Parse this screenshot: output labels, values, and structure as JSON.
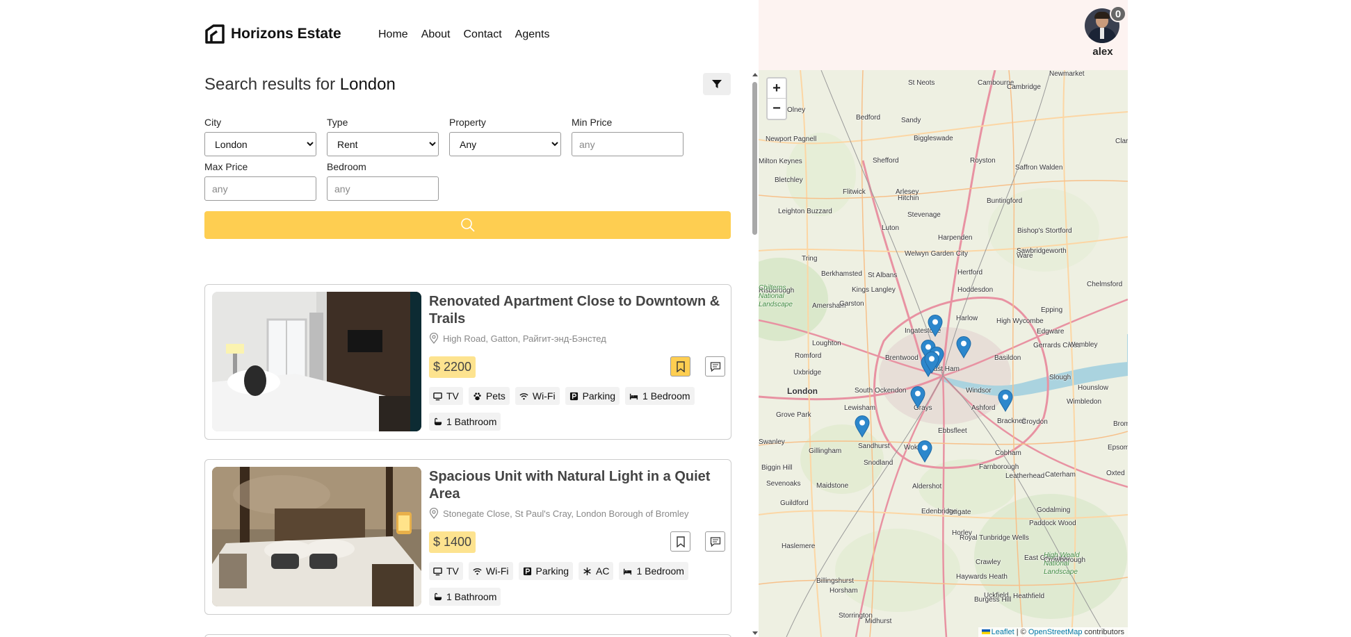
{
  "brand": {
    "name": "Horizons Estate"
  },
  "nav": {
    "home": "Home",
    "about": "About",
    "contact": "Contact",
    "agents": "Agents"
  },
  "user": {
    "name": "alex",
    "notification_count": "0"
  },
  "search": {
    "title_prefix": "Search results for",
    "title_city": "London",
    "fields": {
      "city": {
        "label": "City",
        "value": "London",
        "options": [
          "London"
        ]
      },
      "type": {
        "label": "Type",
        "value": "Rent",
        "options": [
          "Rent"
        ]
      },
      "property": {
        "label": "Property",
        "value": "Any",
        "options": [
          "Any"
        ]
      },
      "min_price": {
        "label": "Min Price",
        "placeholder": "any"
      },
      "max_price": {
        "label": "Max Price",
        "placeholder": "any"
      },
      "bedroom": {
        "label": "Bedroom",
        "placeholder": "any"
      }
    }
  },
  "listings": [
    {
      "title": "Renovated Apartment Close to Downtown & Trails",
      "address": "High Road, Gatton, Райгит-энд-Бэнстед",
      "price": "$ 2200",
      "saved": true,
      "features": [
        "TV",
        "Pets",
        "Wi-Fi",
        "Parking",
        "1 Bedroom",
        "1 Bathroom"
      ]
    },
    {
      "title": "Spacious Unit with Natural Light in a Quiet Area",
      "address": "Stonegate Close, St Paul's Cray, London Borough of Bromley",
      "price": "$ 1400",
      "saved": false,
      "features": [
        "TV",
        "Wi-Fi",
        "Parking",
        "AC",
        "1 Bedroom",
        "1 Bathroom"
      ]
    }
  ],
  "map": {
    "zoom_in": "+",
    "zoom_out": "−",
    "attribution": {
      "leaflet": "Leaflet",
      "sep": " | © ",
      "osm": "OpenStreetMap",
      "contributors": " contributors"
    },
    "labels": [
      "St Neots",
      "Cambourne",
      "Cambridge",
      "Newmarket",
      "Olney",
      "Bedford",
      "Sandy",
      "Newport Pagnell",
      "Biggleswade",
      "Milton Keynes",
      "Shefford",
      "Royston",
      "Saffron Walden",
      "Bletchley",
      "Flitwick",
      "Arlesey",
      "Clar",
      "Hitchin",
      "Buntingford",
      "Leighton Buzzard",
      "Stevenage",
      "Luton",
      "Bishop's Stortford",
      "Tring",
      "Harpenden",
      "Welwyn Garden City",
      "Ware",
      "Sawbridgeworth",
      "Berkhamsted",
      "Hertford",
      "St Albans",
      "Harlow",
      "Chelmsford",
      "Risborough",
      "Kings Langley",
      "Hoddesdon",
      "Epping",
      "Chilterns National Landscape",
      "Amersham",
      "Garston",
      "Ingatestone",
      "High Wycombe",
      "Edgware",
      "Loughton",
      "Brentwood",
      "Gerrards Cross",
      "Wembley",
      "Romford",
      "Basildon",
      "Uxbridge",
      "East Ham",
      "Slough",
      "London",
      "South Ockendon",
      "Windsor",
      "Hounslow",
      "Lewisham",
      "Grays",
      "Ashford",
      "Wimbledon",
      "Grove Park",
      "Ebbsfleet",
      "Bracknell",
      "Croydon",
      "Bromley",
      "Swanley",
      "Gillingham",
      "Sandhurst",
      "Woking",
      "Cobham",
      "Epsom",
      "Biggin Hill",
      "Snodland",
      "Farnborough",
      "Leatherhead",
      "Caterham",
      "Oxted",
      "Sevenoaks",
      "Maidstone",
      "Aldershot",
      "Guildford",
      "Reigate",
      "Godalming",
      "Edenbridge",
      "Paddock Wood",
      "Horley",
      "Royal Tunbridge Wells",
      "Haslemere",
      "Crawley",
      "East Grinstead",
      "Crowborough",
      "High Weald National Landscape",
      "Billingshurst",
      "Horsham",
      "Midhurst",
      "Haywards Heath",
      "Uckfield",
      "Heathfield",
      "Storrington",
      "Burgess Hill"
    ]
  }
}
